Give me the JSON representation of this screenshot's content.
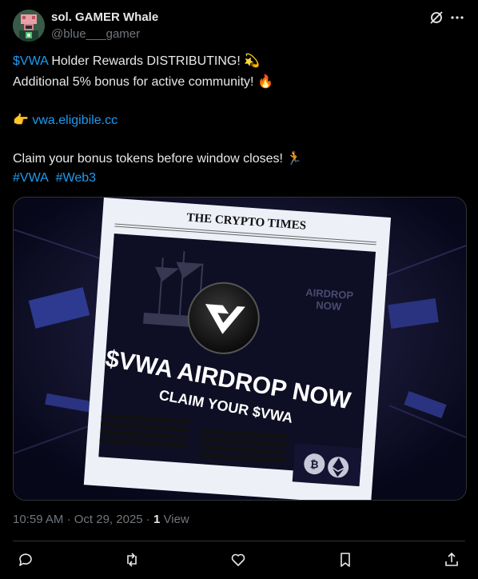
{
  "author": {
    "name": "sol. GAMER Whale",
    "handle": "@blue___gamer"
  },
  "tweet": {
    "line1_link": "$VWA",
    "line1_text": "Holder Rewards DISTRIBUTING!",
    "line1_emoji": "💫",
    "line2_text": "Additional 5% bonus for active community!",
    "line2_emoji": "🔥",
    "line3_emoji": "👉",
    "line3_link": "vwa.eligibile.cc",
    "line4_text": "Claim your bonus tokens before window closes!",
    "line4_emoji": "🏃",
    "hashtag1": "#VWA",
    "hashtag2": "#Web3"
  },
  "media": {
    "newspaper_title": "THE CRYPTO TIMES",
    "headline": "$VWA AIRDROP NOW",
    "subheadline": "CLAIM YOUR $VWA",
    "bg_text_1": "AIRDROP",
    "bg_text_2": "NOW",
    "btc_symbol": "₿"
  },
  "meta": {
    "time": "10:59 AM",
    "separator": "·",
    "date": "Oct 29, 2025",
    "views_count": "1",
    "views_label": "View"
  },
  "icons": {
    "grok": "grok-icon",
    "more": "more-icon",
    "reply": "reply-icon",
    "retweet": "retweet-icon",
    "like": "like-icon",
    "bookmark": "bookmark-icon",
    "share": "share-icon"
  },
  "colors": {
    "link": "#1d9bf0",
    "text": "#e7e9ea",
    "secondary": "#71767b",
    "background": "#000000"
  }
}
